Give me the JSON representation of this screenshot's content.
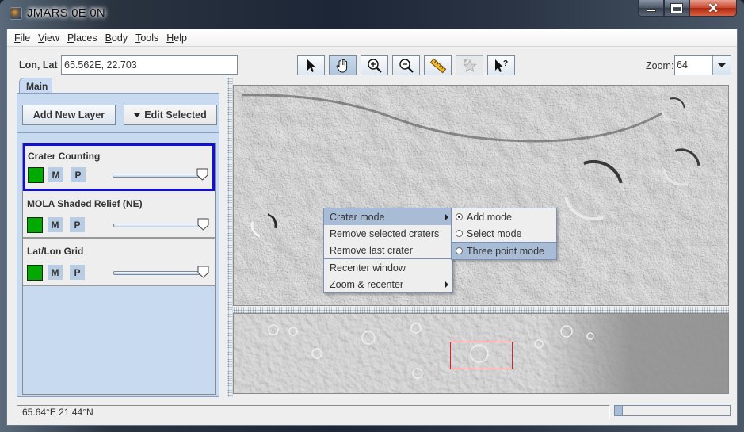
{
  "window": {
    "title": "JMARS 0E 0N",
    "controls": {
      "minimize": "minimize",
      "maximize": "maximize",
      "close": "close"
    }
  },
  "menubar": {
    "items": [
      {
        "label": "File",
        "mnemonic": "F"
      },
      {
        "label": "View",
        "mnemonic": "V"
      },
      {
        "label": "Places",
        "mnemonic": "P"
      },
      {
        "label": "Body",
        "mnemonic": "B"
      },
      {
        "label": "Tools",
        "mnemonic": "T"
      },
      {
        "label": "Help",
        "mnemonic": "H"
      }
    ]
  },
  "location": {
    "label": "Lon, Lat",
    "value": "65.562E, 22.703"
  },
  "toolbar": {
    "tools": [
      {
        "name": "select-tool",
        "icon": "arrow-pointer-icon",
        "selected": false,
        "disabled": false
      },
      {
        "name": "pan-tool",
        "icon": "hand-icon",
        "selected": true,
        "disabled": false
      },
      {
        "name": "zoom-in-tool",
        "icon": "zoom-in-icon",
        "selected": false,
        "disabled": false
      },
      {
        "name": "zoom-out-tool",
        "icon": "zoom-out-icon",
        "selected": false,
        "disabled": false
      },
      {
        "name": "measure-tool",
        "icon": "ruler-icon",
        "selected": false,
        "disabled": false
      },
      {
        "name": "favorite-tool",
        "icon": "star-icon",
        "selected": false,
        "disabled": true
      },
      {
        "name": "investigate-tool",
        "icon": "arrow-question-icon",
        "selected": false,
        "disabled": false
      }
    ]
  },
  "zoom": {
    "label": "Zoom:",
    "value": "64"
  },
  "left_panel": {
    "tab": "Main",
    "add_layer_label": "Add New Layer",
    "edit_selected_label": "Edit Selected",
    "layers": [
      {
        "name": "Crater Counting",
        "selected": true,
        "visible": true,
        "m_label": "M",
        "p_label": "P",
        "opacity": 1.0
      },
      {
        "name": "MOLA Shaded Relief (NE)",
        "selected": false,
        "visible": true,
        "m_label": "M",
        "p_label": "P",
        "opacity": 1.0
      },
      {
        "name": "Lat/Lon Grid",
        "selected": false,
        "visible": true,
        "m_label": "M",
        "p_label": "P",
        "opacity": 1.0
      }
    ]
  },
  "context_menu": {
    "items": [
      {
        "label": "Crater mode",
        "submenu": true,
        "highlighted": true
      },
      {
        "label": "Remove selected craters",
        "submenu": false,
        "highlighted": false
      },
      {
        "label": "Remove last crater",
        "submenu": false,
        "highlighted": false
      },
      {
        "label": "Recenter window",
        "submenu": false,
        "highlighted": false,
        "separator_before": true
      },
      {
        "label": "Zoom & recenter",
        "submenu": true,
        "highlighted": false
      }
    ],
    "crater_mode_submenu": [
      {
        "label": "Add mode",
        "checked": true,
        "highlighted": false
      },
      {
        "label": "Select mode",
        "checked": false,
        "highlighted": false
      },
      {
        "label": "Three point mode",
        "checked": false,
        "highlighted": true
      }
    ]
  },
  "status": {
    "coordinates": "65.64°E  21.44°N",
    "progress_fraction": 0.07
  },
  "colors": {
    "accent_blue": "#1010d8",
    "layer_visible_green": "#00aa00",
    "panel_blue": "#c8daf0",
    "menu_highlight": "#a8bcd6",
    "panner_box_red": "#e02020",
    "close_red": "#c84830"
  }
}
